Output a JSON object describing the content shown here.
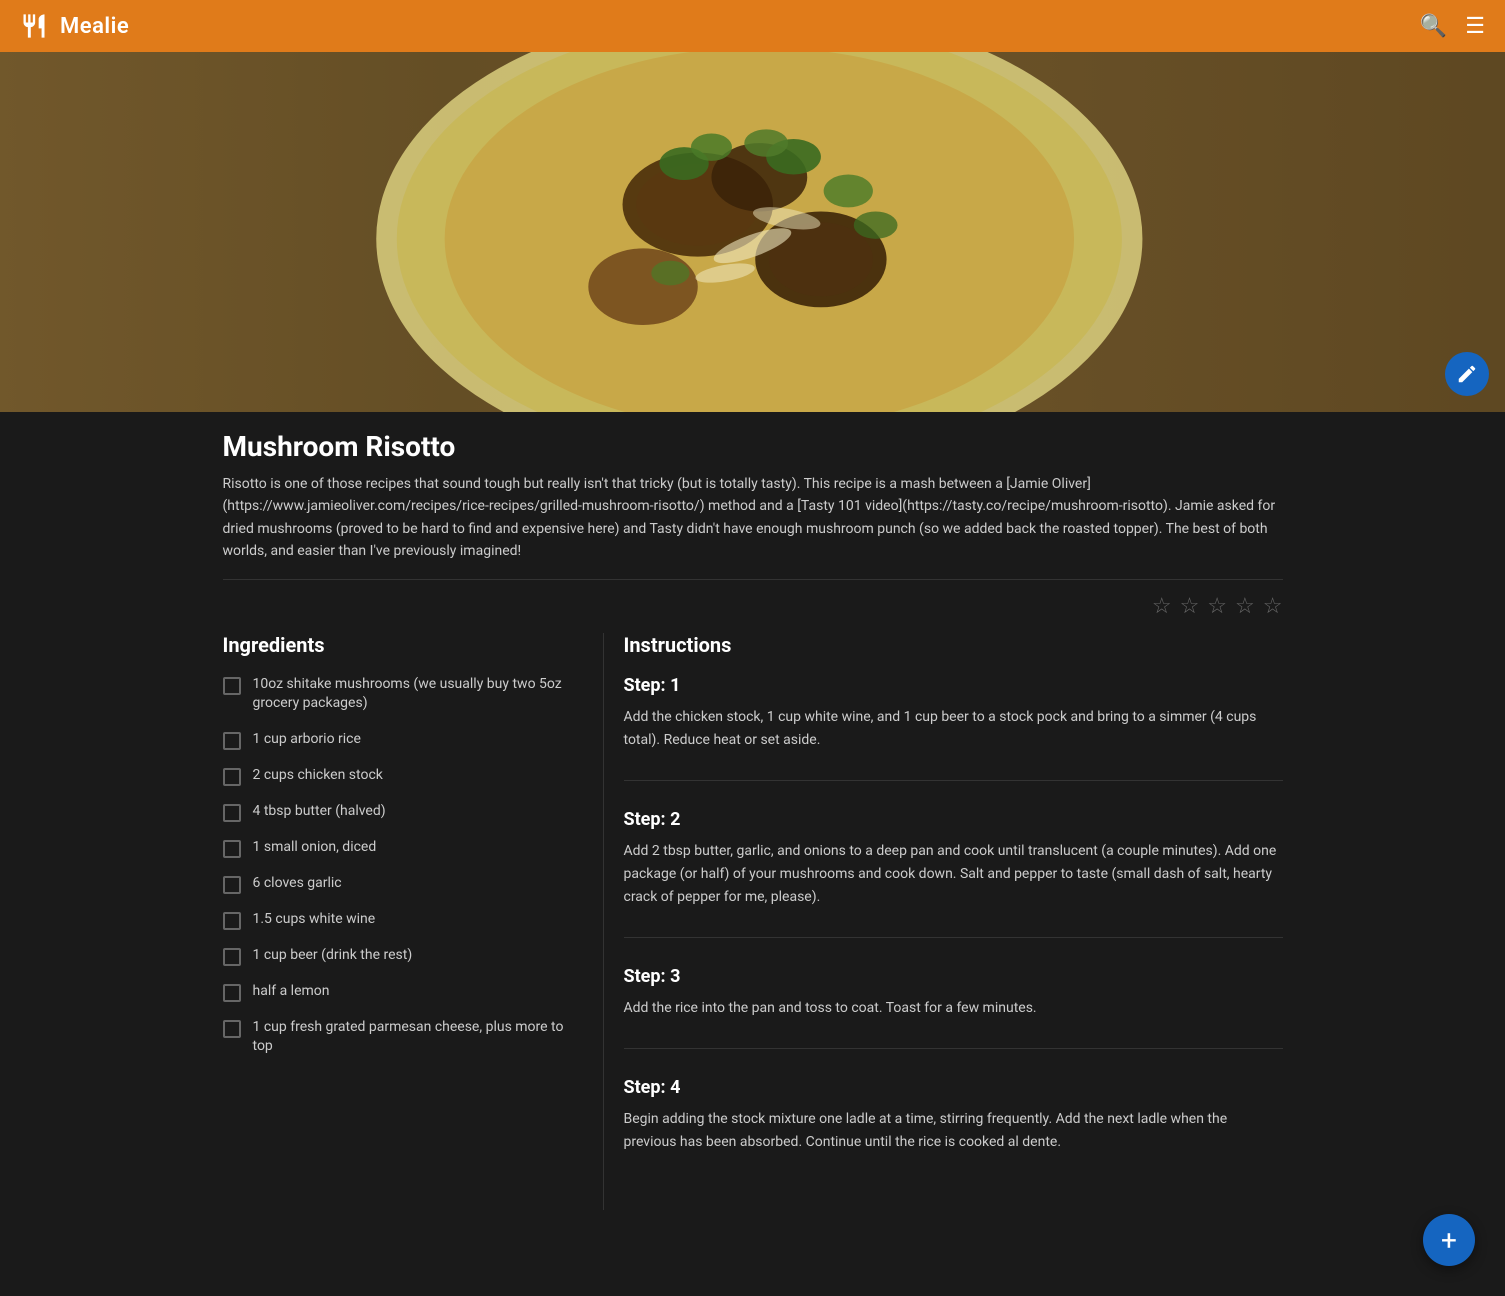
{
  "navbar": {
    "brand": "Mealie",
    "search_icon": "🔍",
    "menu_icon": "☰"
  },
  "recipe": {
    "title": "Mushroom Risotto",
    "description": "Risotto is one of those recipes that sound tough but really isn't that tricky (but is totally tasty). This recipe is a mash between a [Jamie Oliver](https://www.jamieoliver.com/recipes/rice-recipes/grilled-mushroom-risotto/) method and a [Tasty 101 video](https://tasty.co/recipe/mushroom-risotto). Jamie asked for dried mushrooms (proved to be hard to find and expensive here) and Tasty didn't have enough mushroom punch (so we added back the roasted topper). The best of both worlds, and easier than I've previously imagined!",
    "rating": {
      "filled": 0,
      "empty": 5
    }
  },
  "ingredients": {
    "section_title": "Ingredients",
    "items": [
      {
        "id": 1,
        "text": "10oz shitake mushrooms (we usually buy two 5oz grocery packages)"
      },
      {
        "id": 2,
        "text": "1 cup arborio rice"
      },
      {
        "id": 3,
        "text": "2 cups chicken stock"
      },
      {
        "id": 4,
        "text": "4 tbsp butter (halved)"
      },
      {
        "id": 5,
        "text": "1 small onion, diced"
      },
      {
        "id": 6,
        "text": "6 cloves garlic"
      },
      {
        "id": 7,
        "text": "1.5 cups white wine"
      },
      {
        "id": 8,
        "text": "1 cup beer (drink the rest)"
      },
      {
        "id": 9,
        "text": "half a lemon"
      },
      {
        "id": 10,
        "text": "1 cup fresh grated parmesan cheese, plus more to top"
      }
    ]
  },
  "instructions": {
    "section_title": "Instructions",
    "steps": [
      {
        "number": 1,
        "title": "Step: 1",
        "text": "Add the chicken stock, 1 cup white wine, and 1 cup beer to a stock pock and bring to a simmer (4 cups total). Reduce heat or set aside."
      },
      {
        "number": 2,
        "title": "Step: 2",
        "text": "Add 2 tbsp butter, garlic, and onions to a deep pan and cook until translucent (a couple minutes). Add one package (or half) of your mushrooms and cook down. Salt and pepper to taste (small dash of salt, hearty crack of pepper for me, please)."
      },
      {
        "number": 3,
        "title": "Step: 3",
        "text": "Add the rice into the pan and toss to coat. Toast for a few minutes."
      },
      {
        "number": 4,
        "title": "Step: 4",
        "text": "Begin adding the stock mixture one ladle at a time, stirring frequently. Add the next ladle when the previous has been absorbed. Continue until the rice is cooked al dente."
      }
    ]
  },
  "fab": {
    "add_label": "+",
    "edit_label": "✎"
  }
}
